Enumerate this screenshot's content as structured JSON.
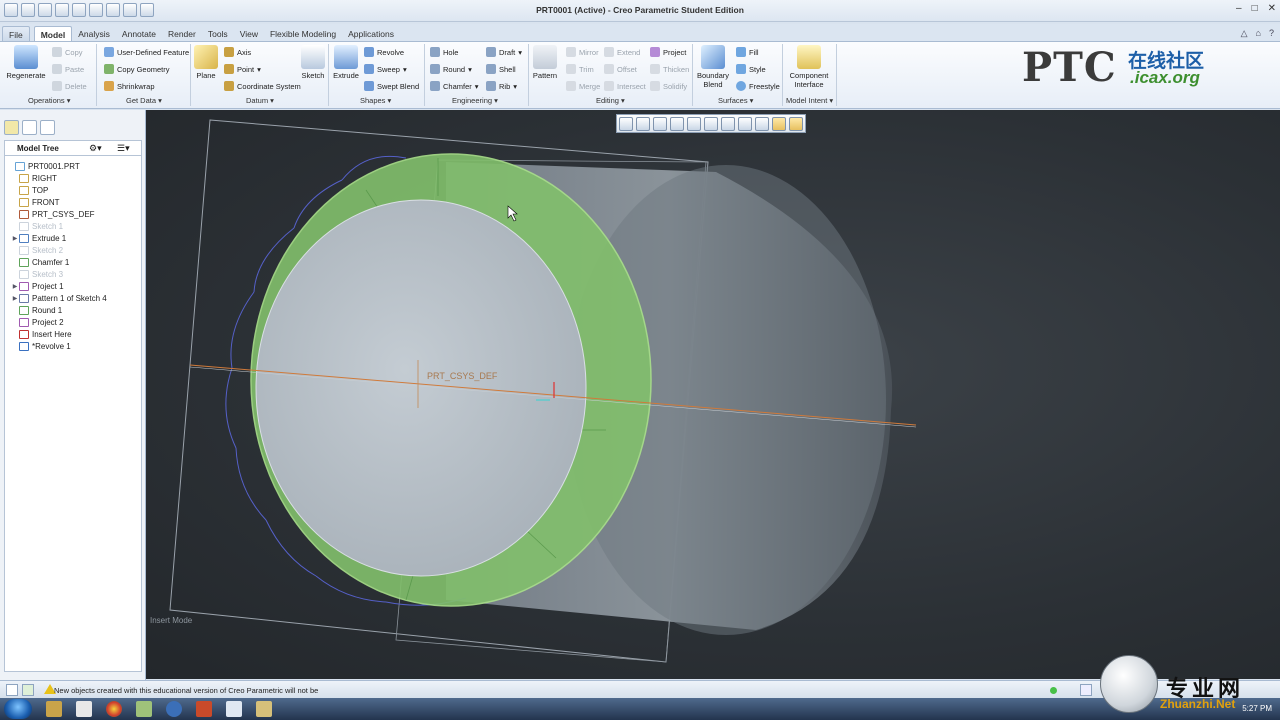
{
  "window": {
    "title": "PRT0001 (Active) - Creo Parametric Student Edition"
  },
  "tabs": [
    "File",
    "Model",
    "Analysis",
    "Annotate",
    "Render",
    "Tools",
    "View",
    "Flexible Modeling",
    "Applications"
  ],
  "active_tab": "Model",
  "ribbon": {
    "operations": {
      "regenerate": "Regenerate",
      "copy": "Copy",
      "paste": "Paste",
      "delete": "Delete"
    },
    "get_data": {
      "udf": "User-Defined Feature",
      "copy_geometry": "Copy Geometry",
      "shrinkwrap": "Shrinkwrap"
    },
    "datum": {
      "plane": "Plane",
      "axis": "Axis",
      "point": "Point",
      "csys": "Coordinate System"
    },
    "sketch": "Sketch",
    "shapes": {
      "extrude": "Extrude",
      "revolve": "Revolve",
      "sweep": "Sweep",
      "swept_blend": "Swept Blend"
    },
    "engineering": {
      "hole": "Hole",
      "round": "Round",
      "chamfer": "Chamfer",
      "draft": "Draft",
      "shell": "Shell",
      "rib": "Rib"
    },
    "editing": {
      "pattern": "Pattern",
      "mirror": "Mirror",
      "trim": "Trim",
      "merge": "Merge",
      "extend": "Extend",
      "offset": "Offset",
      "intersect": "Intersect",
      "project": "Project",
      "thicken": "Thicken",
      "solidify": "Solidify"
    },
    "surfaces": {
      "boundary_blend_1": "Boundary",
      "boundary_blend_2": "Blend",
      "fill": "Fill",
      "style": "Style",
      "freestyle": "Freestyle"
    },
    "model_intent": {
      "ci_1": "Component",
      "ci_2": "Interface"
    },
    "groups": [
      "Operations ▾",
      "Get Data ▾",
      "Datum ▾",
      "Shapes ▾",
      "Engineering ▾",
      "Editing ▾",
      "Surfaces ▾",
      "Model Intent ▾"
    ]
  },
  "logo": {
    "ptc": "PTC",
    "zh": "在线社区",
    "site": ".icax.org"
  },
  "model_tree": {
    "title": "Model Tree",
    "items": [
      {
        "label": "PRT0001.PRT",
        "dim": false,
        "expandable": false
      },
      {
        "label": "RIGHT",
        "dim": false,
        "expandable": false
      },
      {
        "label": "TOP",
        "dim": false,
        "expandable": false
      },
      {
        "label": "FRONT",
        "dim": false,
        "expandable": false
      },
      {
        "label": "PRT_CSYS_DEF",
        "dim": false,
        "expandable": false
      },
      {
        "label": "Sketch 1",
        "dim": true,
        "expandable": false
      },
      {
        "label": "Extrude 1",
        "dim": false,
        "expandable": true
      },
      {
        "label": "Sketch 2",
        "dim": true,
        "expandable": false
      },
      {
        "label": "Chamfer 1",
        "dim": false,
        "expandable": false
      },
      {
        "label": "Sketch 3",
        "dim": true,
        "expandable": false
      },
      {
        "label": "Project 1",
        "dim": false,
        "expandable": true
      },
      {
        "label": "Pattern 1 of Sketch 4",
        "dim": false,
        "expandable": true
      },
      {
        "label": "Round 1",
        "dim": false,
        "expandable": false
      },
      {
        "label": "Project 2",
        "dim": false,
        "expandable": false
      },
      {
        "label": "Insert Here",
        "dim": false,
        "expandable": false
      },
      {
        "label": "*Revolve 1",
        "dim": false,
        "expandable": false
      }
    ]
  },
  "viewport": {
    "csys_label": "PRT_CSYS_DEF",
    "mode": "Insert Mode"
  },
  "status": {
    "message": "New objects created with this educational version of Creo Parametric will not be"
  },
  "taskbar": {
    "clock": "5:27 PM"
  },
  "watermark": {
    "cn": "专业网",
    "site": "Zhuanzhi.Net"
  },
  "colors": {
    "accent_green": "#7fc46a",
    "viewport_bg": "#2e3338",
    "sketch_blue": "#5560c8"
  }
}
